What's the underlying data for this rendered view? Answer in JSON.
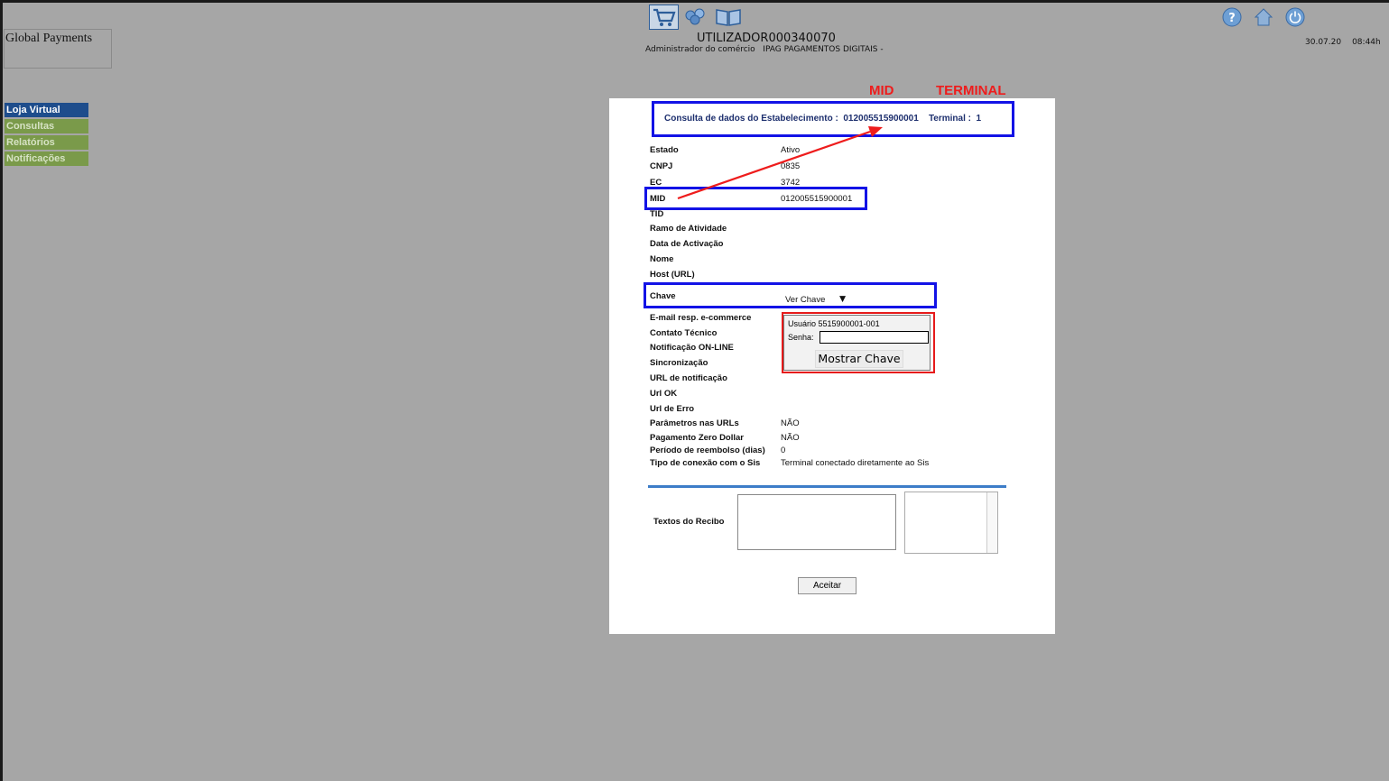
{
  "header": {
    "user_id": "UTILIZADOR000340070",
    "role": "Administrador do comércio",
    "merchant": "IPAG PAGAMENTOS DIGITAIS -",
    "date": "30.07.20",
    "time": "08:44h"
  },
  "logo": {
    "alt": "Global Payments"
  },
  "menu": {
    "items": [
      {
        "label": "Loja Virtual",
        "active": true
      },
      {
        "label": "Consultas"
      },
      {
        "label": "Relatórios"
      },
      {
        "label": "Notificações"
      }
    ]
  },
  "annotations": {
    "mid": "MID",
    "terminal": "TERMINAL",
    "color": "#ee1c1c"
  },
  "panel": {
    "heading_prefix": "Consulta de dados do Estabelecimento :",
    "heading_mid": "012005515900001",
    "heading_terminal_label": "Terminal :",
    "heading_terminal": "1",
    "fields": {
      "estado": {
        "label": "Estado",
        "value": "Ativo"
      },
      "cnpj": {
        "label": "CNPJ",
        "value": "0835"
      },
      "ec": {
        "label": "EC",
        "value": "3742"
      },
      "mid": {
        "label": "MID",
        "value": "012005515900001"
      },
      "tid": {
        "label": "TID",
        "value": ""
      },
      "ramo": {
        "label": "Ramo de Atividade",
        "value": ""
      },
      "data_activacao": {
        "label": "Data de Activação",
        "value": ""
      },
      "nome": {
        "label": "Nome",
        "value": ""
      },
      "host": {
        "label": "Host (URL)",
        "value": ""
      },
      "chave": {
        "label": "Chave",
        "value": "Ver Chave",
        "arrow": "▼"
      },
      "email": {
        "label": "E-mail resp. e-commerce",
        "value": ""
      },
      "contato": {
        "label": "Contato Técnico",
        "value": ""
      },
      "notificacao": {
        "label": "Notificação ON-LINE",
        "value": ""
      },
      "sincronizacao": {
        "label": "Sincronização",
        "value": ""
      },
      "url_notificacao": {
        "label": "URL de notificação",
        "value": ""
      },
      "url_ok": {
        "label": "Url OK",
        "value": ""
      },
      "url_erro": {
        "label": "Url de Erro",
        "value": ""
      },
      "parametros": {
        "label": "Parâmetros nas URLs",
        "value": "NÃO"
      },
      "zero_dollar": {
        "label": "Pagamento Zero Dollar",
        "value": "NÃO"
      },
      "reembolso": {
        "label": "Período de reembolso (dias)",
        "value": "0"
      },
      "conexao": {
        "label": "Tipo de conexão com o Sis",
        "value": "Terminal conectado diretamente ao Sis"
      }
    },
    "recibo_label": "Textos do Recibo",
    "accept_label": "Aceitar"
  },
  "popup": {
    "user_label": "Usuário",
    "user_value": "5515900001-001",
    "password_label": "Senha:",
    "password_value": "",
    "button_label": "Mostrar Chave"
  },
  "colors": {
    "highlight_box": "#1313e6",
    "popup_border": "#e61b1b",
    "menu_active": "#1e4d8c",
    "menu_normal": "#7a9a4a"
  }
}
